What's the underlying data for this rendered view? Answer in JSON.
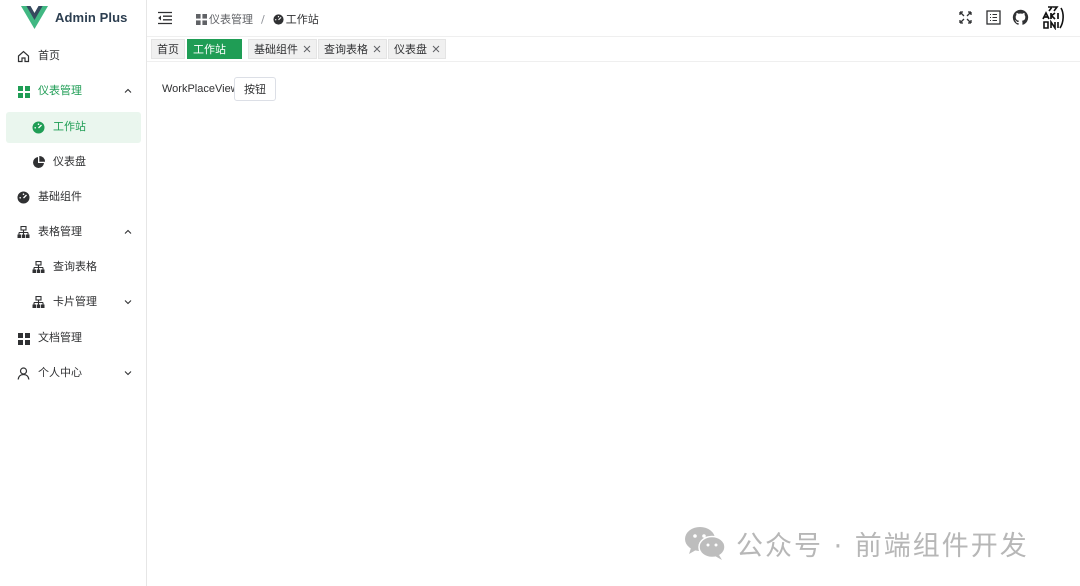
{
  "app": {
    "title": "Admin Plus",
    "brand_color": "#41b883",
    "accent": "#1f9d55"
  },
  "sidebar": {
    "items": [
      {
        "label": "首页",
        "icon": "home-icon"
      },
      {
        "label": "仪表管理",
        "icon": "grid-icon",
        "expanded": true
      },
      {
        "label": "工作站",
        "icon": "speedometer-icon",
        "active": true
      },
      {
        "label": "仪表盘",
        "icon": "pie-chart-icon"
      },
      {
        "label": "基础组件",
        "icon": "speedometer-icon"
      },
      {
        "label": "表格管理",
        "icon": "org-chart-icon",
        "expanded": true
      },
      {
        "label": "查询表格",
        "icon": "org-chart-icon"
      },
      {
        "label": "卡片管理",
        "icon": "org-chart-icon",
        "expanded": false
      },
      {
        "label": "文档管理",
        "icon": "grid-icon"
      },
      {
        "label": "个人中心",
        "icon": "user-icon",
        "expanded": false
      }
    ]
  },
  "header": {
    "breadcrumb": [
      {
        "label": "仪表管理",
        "icon": "grid-icon"
      },
      {
        "label": "工作站",
        "icon": "speedometer-icon"
      }
    ],
    "separator": "/",
    "icons": [
      "fullscreen-icon",
      "document-icon",
      "github-icon",
      "avatar"
    ]
  },
  "tags": [
    {
      "label": "首页",
      "closable": false
    },
    {
      "label": "工作站",
      "closable": false,
      "active": true
    },
    {
      "label": "基础组件",
      "closable": true
    },
    {
      "label": "查询表格",
      "closable": true
    },
    {
      "label": "仪表盘",
      "closable": true
    }
  ],
  "main": {
    "view_label": "WorkPlaceView",
    "button_label": "按钮"
  },
  "watermark": {
    "text": "公众号 · 前端组件开发"
  }
}
